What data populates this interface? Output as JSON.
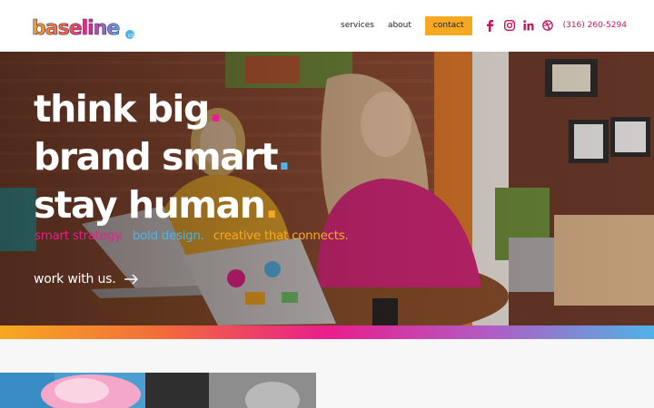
{
  "brand": {
    "logo_text": "baseline"
  },
  "nav": {
    "services": "services",
    "about": "about",
    "contact": "contact",
    "phone": "(316) 260-5294",
    "social": [
      "facebook-icon",
      "instagram-icon",
      "linkedin-icon",
      "dribbble-icon"
    ]
  },
  "hero": {
    "line1": "think big",
    "line2": "brand smart",
    "line3": "stay human",
    "tag1": "smart strategy.",
    "tag2": "bold design.",
    "tag3": "creative that connects.",
    "cta": "work with us."
  },
  "colors": {
    "pink": "#e91e8c",
    "blue": "#4fb3e8",
    "yellow": "#f7a821",
    "orange": "#f26b3a",
    "purple": "#b05cc4"
  }
}
